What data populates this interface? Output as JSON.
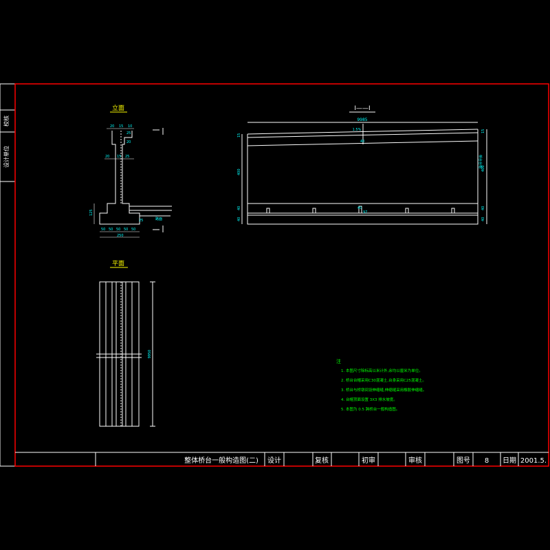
{
  "side_tab": {
    "top": "校核",
    "bottom": "设计单位"
  },
  "elevation_view": {
    "title": "立面",
    "dims": [
      "20",
      "15",
      "10",
      "25",
      "20",
      "20",
      "15",
      "25",
      "25",
      "125",
      "50",
      "50",
      "50",
      "50",
      "50",
      "250"
    ],
    "section_mark": "I",
    "note_label": "路面"
  },
  "plan_view": {
    "title": "平面",
    "length_label": "9950"
  },
  "section_view": {
    "title": "I——I",
    "top_length": "9985",
    "slope_label": "1.5%",
    "left_dims": [
      "15",
      "400",
      "40",
      "40"
    ],
    "right_dims": [
      "15",
      "400",
      "40",
      "40"
    ],
    "right_note": "桥台台帽",
    "mid_labels": [
      "40",
      "40",
      "97"
    ]
  },
  "notes": {
    "heading": "注",
    "items": [
      "1. 本图尺寸除标高以米计外,余均以厘米为单位。",
      "2. 桥台台帽采用C30混凝土,台身采用C25混凝土。",
      "3. 桥台与桥墩间设伸缩缝,伸缩缝采用橡胶伸缩缝。",
      "4. 台帽顶面设置 3X3 排水坡度。",
      "5. 本图为 0.5 跨桥台一般构造图。"
    ]
  },
  "title_block": {
    "drawing_title": "整体桥台一般构造图(二)",
    "design_label": "设计",
    "review_label": "复核",
    "preliminary_label": "初审",
    "approve_label": "审核",
    "drawing_no_label": "图号",
    "drawing_no": "8",
    "date_label": "日期",
    "date": "2001.5."
  },
  "colors": {
    "background": "#000000",
    "frame": "#ff0000",
    "line": "#ffffff",
    "dimension": "#00ffff",
    "note": "#00ff00",
    "title": "#ffff00"
  }
}
